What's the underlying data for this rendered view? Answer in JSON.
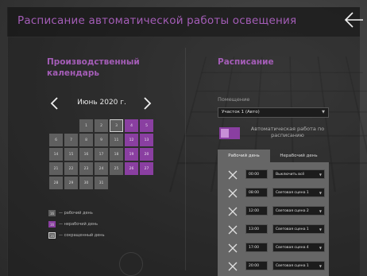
{
  "header": {
    "title": "Расписание автоматической работы освещения"
  },
  "calendar": {
    "title": "Производственный календарь",
    "month_label": "Июнь 2020 г.",
    "days": [
      {
        "n": "",
        "t": "empty"
      },
      {
        "n": "",
        "t": "empty"
      },
      {
        "n": "1",
        "t": "work"
      },
      {
        "n": "2",
        "t": "work"
      },
      {
        "n": "3",
        "t": "short"
      },
      {
        "n": "4",
        "t": "weekend"
      },
      {
        "n": "5",
        "t": "weekend"
      },
      {
        "n": "6",
        "t": "work"
      },
      {
        "n": "7",
        "t": "work"
      },
      {
        "n": "8",
        "t": "work"
      },
      {
        "n": "9",
        "t": "work"
      },
      {
        "n": "11",
        "t": "work"
      },
      {
        "n": "12",
        "t": "weekend"
      },
      {
        "n": "13",
        "t": "weekend"
      },
      {
        "n": "14",
        "t": "work"
      },
      {
        "n": "15",
        "t": "work"
      },
      {
        "n": "16",
        "t": "work"
      },
      {
        "n": "17",
        "t": "work"
      },
      {
        "n": "18",
        "t": "work"
      },
      {
        "n": "19",
        "t": "weekend"
      },
      {
        "n": "20",
        "t": "weekend"
      },
      {
        "n": "21",
        "t": "work"
      },
      {
        "n": "22",
        "t": "work"
      },
      {
        "n": "23",
        "t": "work"
      },
      {
        "n": "24",
        "t": "work"
      },
      {
        "n": "25",
        "t": "work"
      },
      {
        "n": "26",
        "t": "weekend"
      },
      {
        "n": "27",
        "t": "weekend"
      },
      {
        "n": "28",
        "t": "work"
      },
      {
        "n": "29",
        "t": "work"
      },
      {
        "n": "30",
        "t": "work"
      },
      {
        "n": "31",
        "t": "work"
      },
      {
        "n": "",
        "t": "empty"
      },
      {
        "n": "",
        "t": "empty"
      },
      {
        "n": "",
        "t": "empty"
      }
    ],
    "legend": [
      {
        "sample": "16",
        "type": "work",
        "label": "— рабочий день"
      },
      {
        "sample": "16",
        "type": "weekend",
        "label": "— нерабочий день"
      },
      {
        "sample": "16",
        "type": "short",
        "label": "— сокращенный день"
      }
    ]
  },
  "schedule": {
    "title": "Расписание",
    "room_label": "Помещение",
    "room_value": "Участок 1 (Авто)",
    "toggle_label": "Автоматическая работа по расписанию",
    "tabs": [
      {
        "label": "Рабочий день",
        "active": true
      },
      {
        "label": "Нерабочий день",
        "active": false
      }
    ],
    "rows": [
      {
        "time": "00:00",
        "scene": "Выключить всё"
      },
      {
        "time": "08:00",
        "scene": "Световая сцена 1"
      },
      {
        "time": "12:00",
        "scene": "Световая сцена 2"
      },
      {
        "time": "13:00",
        "scene": "Световая сцена 1"
      },
      {
        "time": "17:00",
        "scene": "Световая сцена 4"
      },
      {
        "time": "20:00",
        "scene": "Световая сцена 1"
      }
    ]
  },
  "colors": {
    "accent": "#a45db7",
    "weekend_cell": "#8a3fa1",
    "work_cell": "#5f5f5f",
    "panel": "#666666"
  }
}
